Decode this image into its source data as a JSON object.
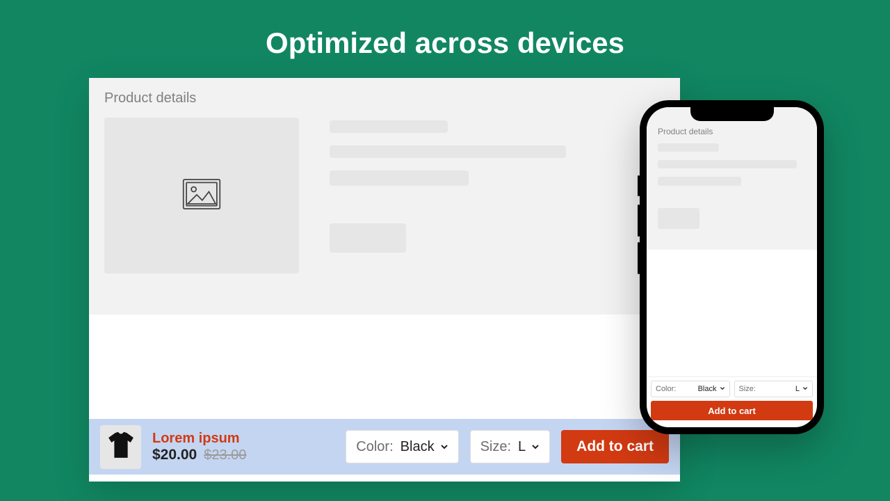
{
  "headline": "Optimized across devices",
  "section_title": "Product details",
  "product": {
    "name": "Lorem ipsum",
    "price": "$20.00",
    "compare_price": "$23.00"
  },
  "options": {
    "color": {
      "label": "Color:",
      "value": "Black"
    },
    "size": {
      "label": "Size:",
      "value": "L"
    }
  },
  "cta": "Add to cart",
  "mobile": {
    "section_title": "Product details",
    "options": {
      "color": {
        "label": "Color:",
        "value": "Black"
      },
      "size": {
        "label": "Size:",
        "value": "L"
      }
    },
    "cta": "Add to cart"
  },
  "colors": {
    "accent": "#d23a12",
    "bg": "#118661"
  }
}
